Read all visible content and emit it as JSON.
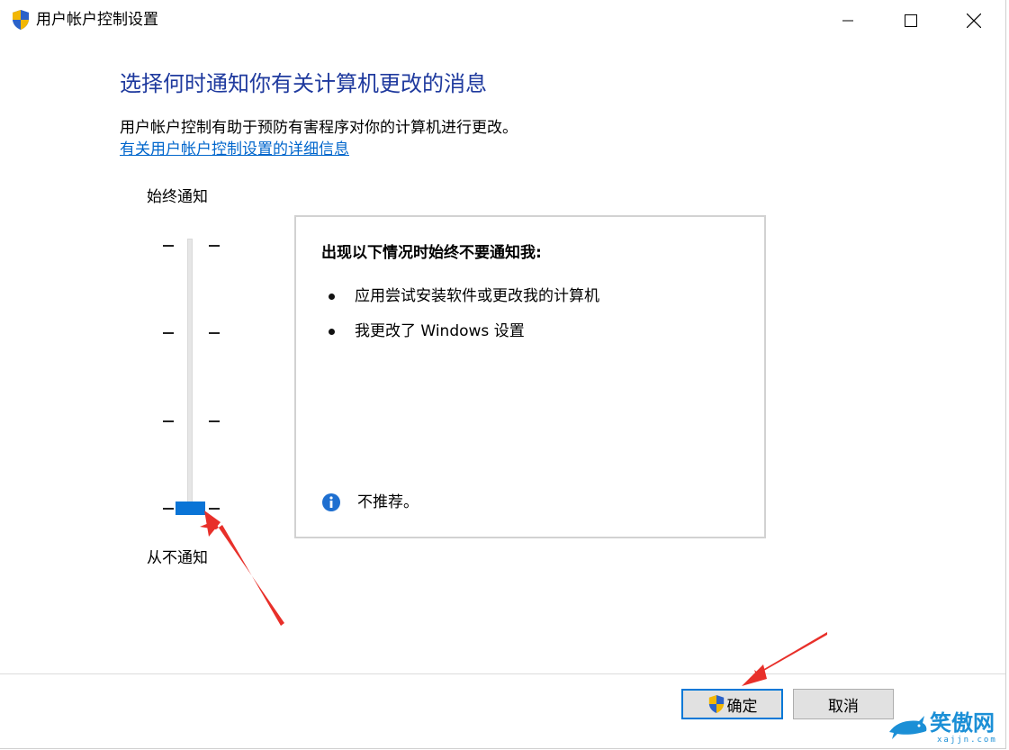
{
  "window": {
    "title": "用户帐户控制设置",
    "icon": "uac-shield-icon"
  },
  "content": {
    "heading": "选择何时通知你有关计算机更改的消息",
    "description": "用户帐户控制有助于预防有害程序对你的计算机进行更改。",
    "link": "有关用户帐户控制设置的详细信息"
  },
  "slider": {
    "top_label": "始终通知",
    "bottom_label": "从不通知",
    "levels": 4,
    "selected_level": 1
  },
  "panel": {
    "title": "出现以下情况时始终不要通知我:",
    "bullets": [
      "应用尝试安装软件或更改我的计算机",
      "我更改了 Windows 设置"
    ],
    "info_text": "不推荐。"
  },
  "buttons": {
    "ok": "确定",
    "cancel": "取消"
  },
  "watermark": {
    "text": "笑傲网",
    "sub": "xajjn.com"
  },
  "colors": {
    "heading": "#1f3a9e",
    "link": "#0066cc",
    "accent": "#0a74d6",
    "annotation": "#e8302a"
  }
}
